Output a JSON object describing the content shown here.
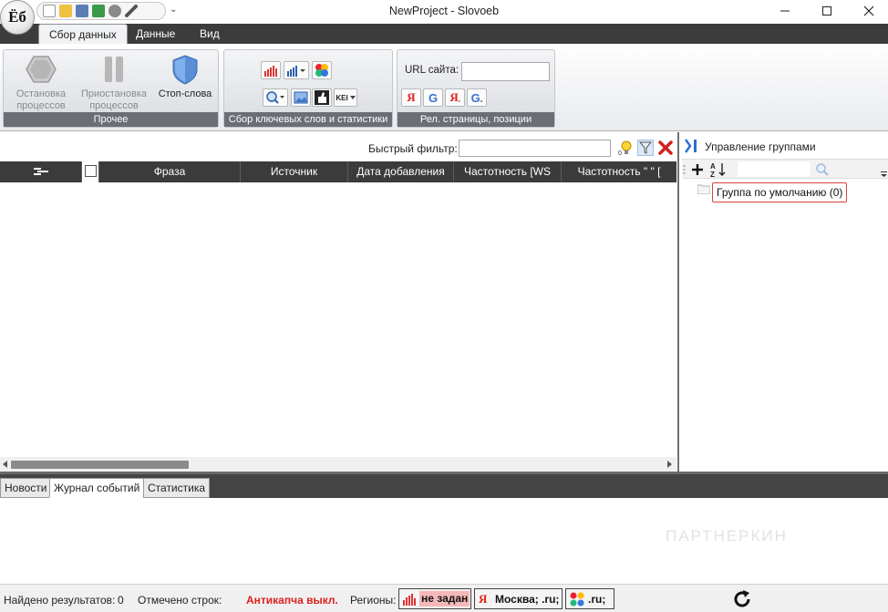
{
  "window": {
    "title": "NewProject - Slovoeb",
    "logo_text": "Ёб",
    "qat_more": "⌄"
  },
  "ribbon": {
    "tabs": [
      {
        "label": "Сбор данных",
        "active": true
      },
      {
        "label": "Данные",
        "active": false
      },
      {
        "label": "Вид",
        "active": false
      }
    ],
    "groups": {
      "other": {
        "caption": "Прочее",
        "stop_processes": "Остановка процессов",
        "pause_processes": "Приостановка процессов",
        "stop_words": "Стоп-слова"
      },
      "collect": {
        "caption": "Сбор ключевых слов и статистики",
        "kei_label": "KEI"
      },
      "rel": {
        "caption": "Рел. страницы, позиции",
        "url_label": "URL сайта:",
        "url_value": ""
      }
    }
  },
  "main": {
    "quick_filter_label": "Быстрый фильтр:",
    "quick_filter_value": "",
    "columns": [
      "Фраза",
      "Источник",
      "Дата добавления",
      "Частотность [WS",
      "Частотность \" \" ["
    ]
  },
  "group_panel": {
    "title": "Управление группами",
    "search_value": "",
    "tree": [
      {
        "label": "Группа по умолчанию (0)"
      }
    ]
  },
  "log_tabs": [
    {
      "label": "Новости",
      "active": false
    },
    {
      "label": "Журнал событий",
      "active": true
    },
    {
      "label": "Статистика",
      "active": false
    }
  ],
  "watermark": "ПАРТНЕРКИН",
  "status": {
    "found_label": "Найдено результатов:",
    "found_value": "0",
    "marked_label": "Отмечено строк:",
    "marked_value": "",
    "anticaptcha": "Антикапча выкл.",
    "regions_label": "Регионы:",
    "region_wordstat": "не задан",
    "region_yandex": "Москва; .ru;",
    "region_google": ".ru;"
  },
  "colors": {
    "anticaptcha": "#e02020",
    "dark_strip": "#3c3c3c",
    "highlight_border": "#e04040"
  }
}
